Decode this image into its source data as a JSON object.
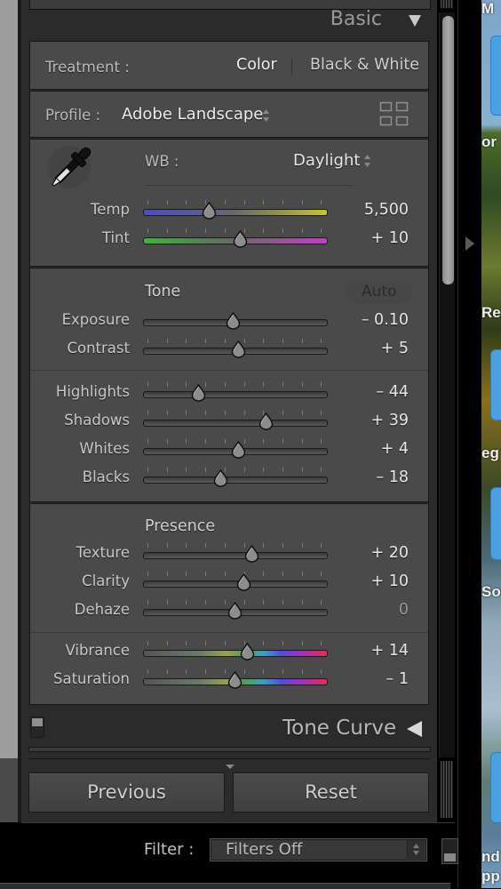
{
  "panel": {
    "title": "Basic",
    "collapse_icon": "triangle-down-icon"
  },
  "treatment": {
    "label": "Treatment :",
    "options": [
      "Color",
      "Black & White"
    ],
    "selected": "Color"
  },
  "profile": {
    "label": "Profile :",
    "value": "Adobe Landscape",
    "browser_icon": "grid-icon"
  },
  "white_balance": {
    "label": "WB :",
    "value": "Daylight",
    "picker_icon": "eyedropper-icon"
  },
  "sliders_wb": [
    {
      "label": "Temp",
      "value": "5,500",
      "position": 0.36,
      "track": "temp"
    },
    {
      "label": "Tint",
      "value": "+ 10",
      "position": 0.53,
      "track": "tint"
    }
  ],
  "tone": {
    "heading": "Tone",
    "auto_label": "Auto",
    "sliders_a": [
      {
        "label": "Exposure",
        "value": "– 0.10",
        "position": 0.49,
        "track": "gray",
        "ticks": false
      },
      {
        "label": "Contrast",
        "value": "+ 5",
        "position": 0.52,
        "track": "gray",
        "ticks": true
      }
    ],
    "sliders_b": [
      {
        "label": "Highlights",
        "value": "– 44",
        "position": 0.3,
        "track": "gray",
        "ticks": true
      },
      {
        "label": "Shadows",
        "value": "+ 39",
        "position": 0.67,
        "track": "gray",
        "ticks": true
      },
      {
        "label": "Whites",
        "value": "+ 4",
        "position": 0.52,
        "track": "gray",
        "ticks": true
      },
      {
        "label": "Blacks",
        "value": "– 18",
        "position": 0.42,
        "track": "gray",
        "ticks": true
      }
    ]
  },
  "presence": {
    "heading": "Presence",
    "sliders_a": [
      {
        "label": "Texture",
        "value": "+ 20",
        "position": 0.59,
        "track": "gray",
        "ticks": true
      },
      {
        "label": "Clarity",
        "value": "+ 10",
        "position": 0.55,
        "track": "gray",
        "ticks": true
      },
      {
        "label": "Dehaze",
        "value": "0",
        "position": 0.5,
        "track": "gray",
        "ticks": true,
        "dim": true
      }
    ],
    "sliders_b": [
      {
        "label": "Vibrance",
        "value": "+ 14",
        "position": 0.57,
        "track": "color",
        "ticks": true
      },
      {
        "label": "Saturation",
        "value": "– 1",
        "position": 0.5,
        "track": "color",
        "ticks": true
      }
    ]
  },
  "next_panel": {
    "title": "Tone Curve",
    "expand_icon": "triangle-left-icon"
  },
  "buttons": {
    "previous": "Previous",
    "reset": "Reset"
  },
  "filter": {
    "label": "Filter :",
    "value": "Filters Off"
  },
  "filmstrip_labels": [
    "M",
    "or",
    "Re",
    "eg",
    "So",
    "nd",
    "pp"
  ],
  "colors": {
    "panel_bg": "#4a4a4a",
    "panel_dark": "#2b2b2b",
    "text": "#d6d6d6"
  }
}
